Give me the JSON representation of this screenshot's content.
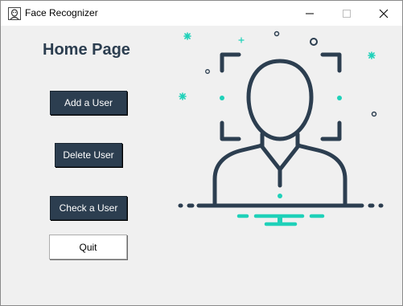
{
  "window": {
    "title": "Face Recognizer",
    "app_icon": "face-app-icon",
    "controls": {
      "minimize": "minimize-icon",
      "maximize": "maximize-icon",
      "close": "close-icon"
    }
  },
  "main": {
    "title": "Home Page",
    "buttons": {
      "add_user": "Add a User",
      "delete_user": "Delete User",
      "check_user": "Check a User",
      "quit": "Quit"
    },
    "illustration": "face-scan-illustration"
  },
  "colors": {
    "primary": "#2c3e50",
    "accent": "#1fd1b9",
    "background": "#f0f0f0"
  }
}
